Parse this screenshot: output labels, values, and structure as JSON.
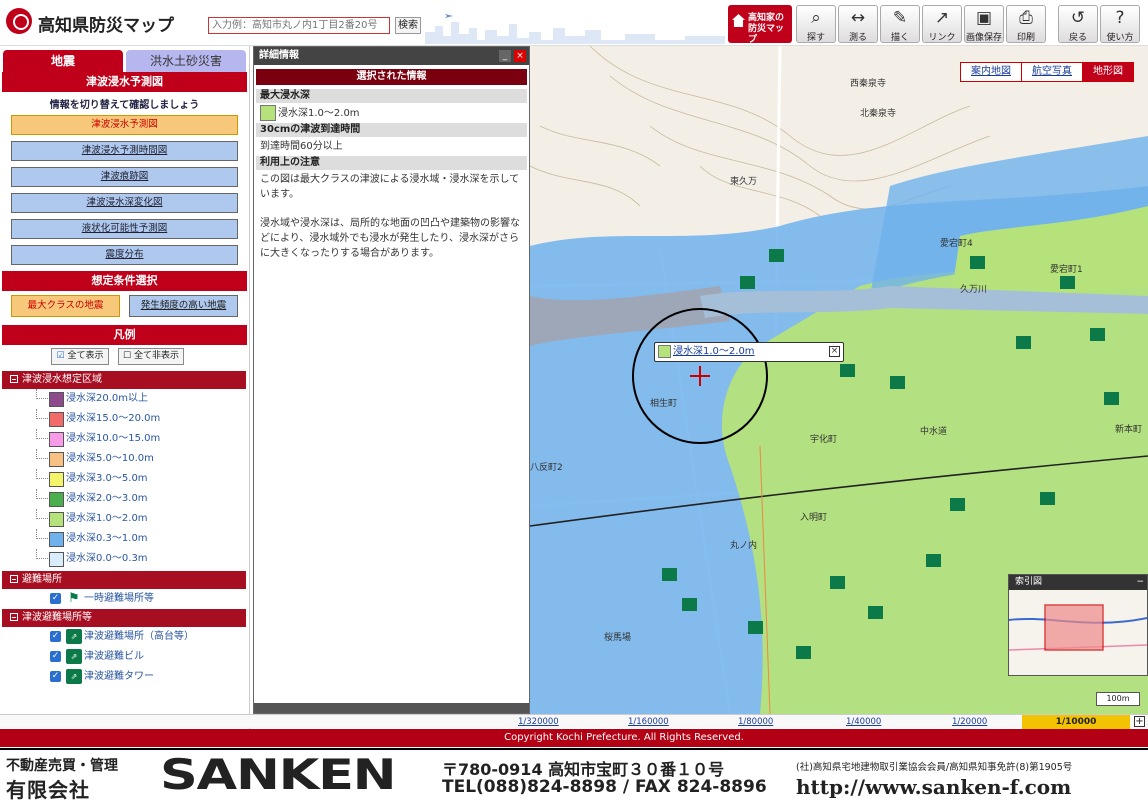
{
  "header": {
    "app_title": "高知県防災マップ",
    "search_placeholder": "入力例：高知市丸ノ内1丁目2番20号",
    "search_button": "検索",
    "home_map_line1": "高知家の",
    "home_map_line2": "防災マップ",
    "tools": [
      {
        "label": "探す",
        "icon": "magnifier-icon"
      },
      {
        "label": "測る",
        "icon": "ruler-icon"
      },
      {
        "label": "描く",
        "icon": "palette-icon"
      },
      {
        "label": "リンク",
        "icon": "link-icon"
      },
      {
        "label": "画像保存",
        "icon": "image-save-icon"
      },
      {
        "label": "印刷",
        "icon": "printer-icon"
      },
      {
        "label": "戻る",
        "icon": "undo-icon"
      },
      {
        "label": "使い方",
        "icon": "help-icon"
      }
    ]
  },
  "left_panel": {
    "tabs": [
      "地震",
      "洪水土砂災害"
    ],
    "section_title": "津波浸水予測図",
    "hint": "情報を切り替えて確認しましょう",
    "menu": [
      {
        "label": "津波浸水予測図",
        "active": true
      },
      {
        "label": "津波浸水予測時間図",
        "active": false
      },
      {
        "label": "津波痕跡図",
        "active": false
      },
      {
        "label": "津波浸水深変化図",
        "active": false
      },
      {
        "label": "液状化可能性予測図",
        "active": false
      },
      {
        "label": "震度分布",
        "active": false
      }
    ],
    "conditions_title": "想定条件選択",
    "condition_max": "最大クラスの地震",
    "condition_frequent": "発生頻度の高い地震",
    "legend_title": "凡例",
    "show_all": "全て表示",
    "hide_all": "全て非表示",
    "tsunami_group": "津波浸水想定区域",
    "depths": [
      {
        "label": "浸水深20.0m以上",
        "color": "#8e4b8c"
      },
      {
        "label": "浸水深15.0〜20.0m",
        "color": "#f26b6b"
      },
      {
        "label": "浸水深10.0〜15.0m",
        "color": "#f79be8"
      },
      {
        "label": "浸水深5.0〜10.0m",
        "color": "#f7c184"
      },
      {
        "label": "浸水深3.0〜5.0m",
        "color": "#f4f46a"
      },
      {
        "label": "浸水深2.0〜3.0m",
        "color": "#4caf4f"
      },
      {
        "label": "浸水深1.0〜2.0m",
        "color": "#b5e27a"
      },
      {
        "label": "浸水深0.3〜1.0m",
        "color": "#6fb1ec"
      },
      {
        "label": "浸水深0.0〜0.3m",
        "color": "#d8ecfb"
      }
    ],
    "evac_group": "避難場所",
    "evac_items": [
      "一時避難場所等"
    ],
    "tsunami_evac_group": "津波避難場所等",
    "tsunami_evac_items": [
      "津波避難場所（高台等）",
      "津波避難ビル",
      "津波避難タワー"
    ]
  },
  "detail": {
    "title": "詳細情報",
    "subtitle": "選択された情報",
    "max_depth_head": "最大浸水深",
    "max_depth_value": "浸水深1.0〜2.0m",
    "arrival_head": "30cmの津波到達時間",
    "arrival_value": "到達時間60分以上",
    "notes_head": "利用上の注意",
    "note1": "この図は最大クラスの津波による浸水域・浸水深を示しています。",
    "note2": "浸水域や浸水深は、局所的な地面の凹凸や建築物の影響などにより、浸水域外でも浸水が発生したり、浸水深がさらに大きくなったりする場合があります。"
  },
  "map": {
    "tabs": [
      "案内地図",
      "航空写真",
      "地形図"
    ],
    "active_tab": "地形図",
    "popup_text": "浸水深1.0〜2.0m",
    "labels": [
      "西秦泉寺",
      "東久万",
      "愛宕町4",
      "愛宕町1",
      "北秦泉寺",
      "久万川",
      "中水道",
      "八反町2",
      "宇化町",
      "入明町",
      "桜馬場",
      "丸ノ内",
      "新本町",
      "相生町"
    ],
    "index_title": "索引図",
    "scale_label": "100m"
  },
  "scale_bar": {
    "options": [
      "1/320000",
      "1/160000",
      "1/80000",
      "1/40000",
      "1/20000"
    ],
    "active": "1/10000"
  },
  "footer": {
    "copyright": "Copyright Kochi Prefecture. All Rights Reserved."
  },
  "ad": {
    "line1": "不動産売買・管理",
    "line2": "有限会社",
    "brand": "SANKEN",
    "address": "〒780-0914 高知市宝町３０番１０号",
    "tel": "TEL(088)824-8898 / FAX 824-8896",
    "association": "(社)高知県宅地建物取引業協会会員/高知県知事免許(8)第1905号",
    "url": "http://www.sanken-f.com"
  },
  "colors": {
    "brand_red": "#c0001a",
    "flood_green": "#b5e27a",
    "flood_blue": "#6fb1ec",
    "active_scale": "#f2c300"
  }
}
